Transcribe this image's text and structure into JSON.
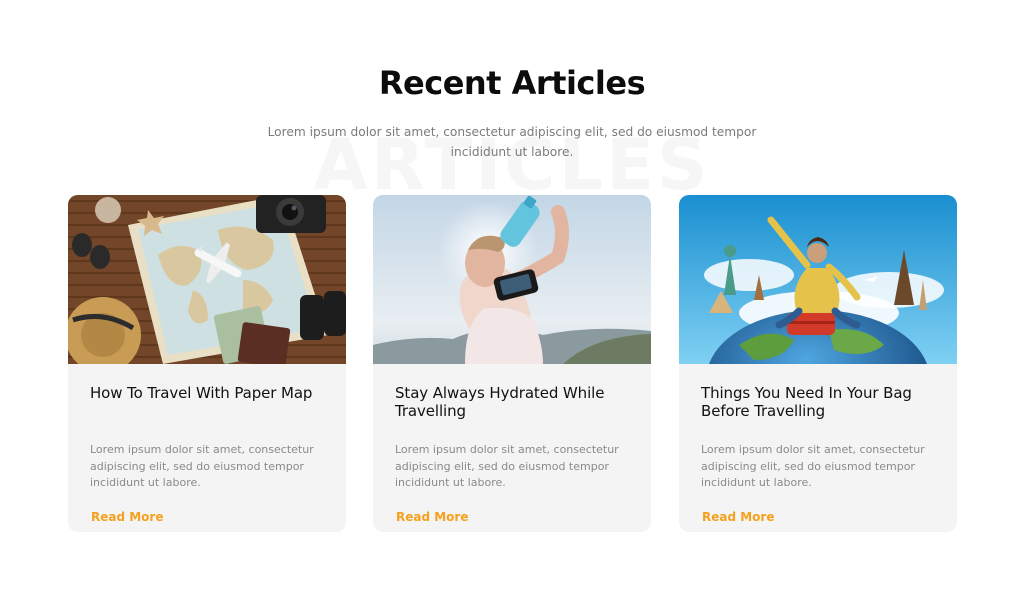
{
  "section": {
    "watermark": "ARTICLES",
    "title": "Recent Articles",
    "subtitle": "Lorem ipsum dolor sit amet, consectetur adipiscing elit, sed do eiusmod tempor incididunt ut labore."
  },
  "colors": {
    "accent": "#f5a11d",
    "card_background": "#f4f4f4",
    "heading": "#0c0c0c",
    "body_text": "#8a8a8a"
  },
  "articles": [
    {
      "image_icon": "travel-map-photo",
      "title": "How To Travel With Paper Map",
      "excerpt": "Lorem ipsum dolor sit amet, consectetur adipiscing elit, sed do eiusmod tempor incididunt ut labore.",
      "read_more": "Read More"
    },
    {
      "image_icon": "hydration-photo",
      "title": "Stay Always Hydrated While Travelling",
      "excerpt": "Lorem ipsum dolor sit amet, consectetur adipiscing elit, sed do eiusmod tempor incididunt ut labore.",
      "read_more": "Read More"
    },
    {
      "image_icon": "globe-suitcase-photo",
      "title": "Things You Need In Your Bag Before Travelling",
      "excerpt": "Lorem ipsum dolor sit amet, consectetur adipiscing elit, sed do eiusmod tempor incididunt ut labore.",
      "read_more": "Read More"
    }
  ]
}
